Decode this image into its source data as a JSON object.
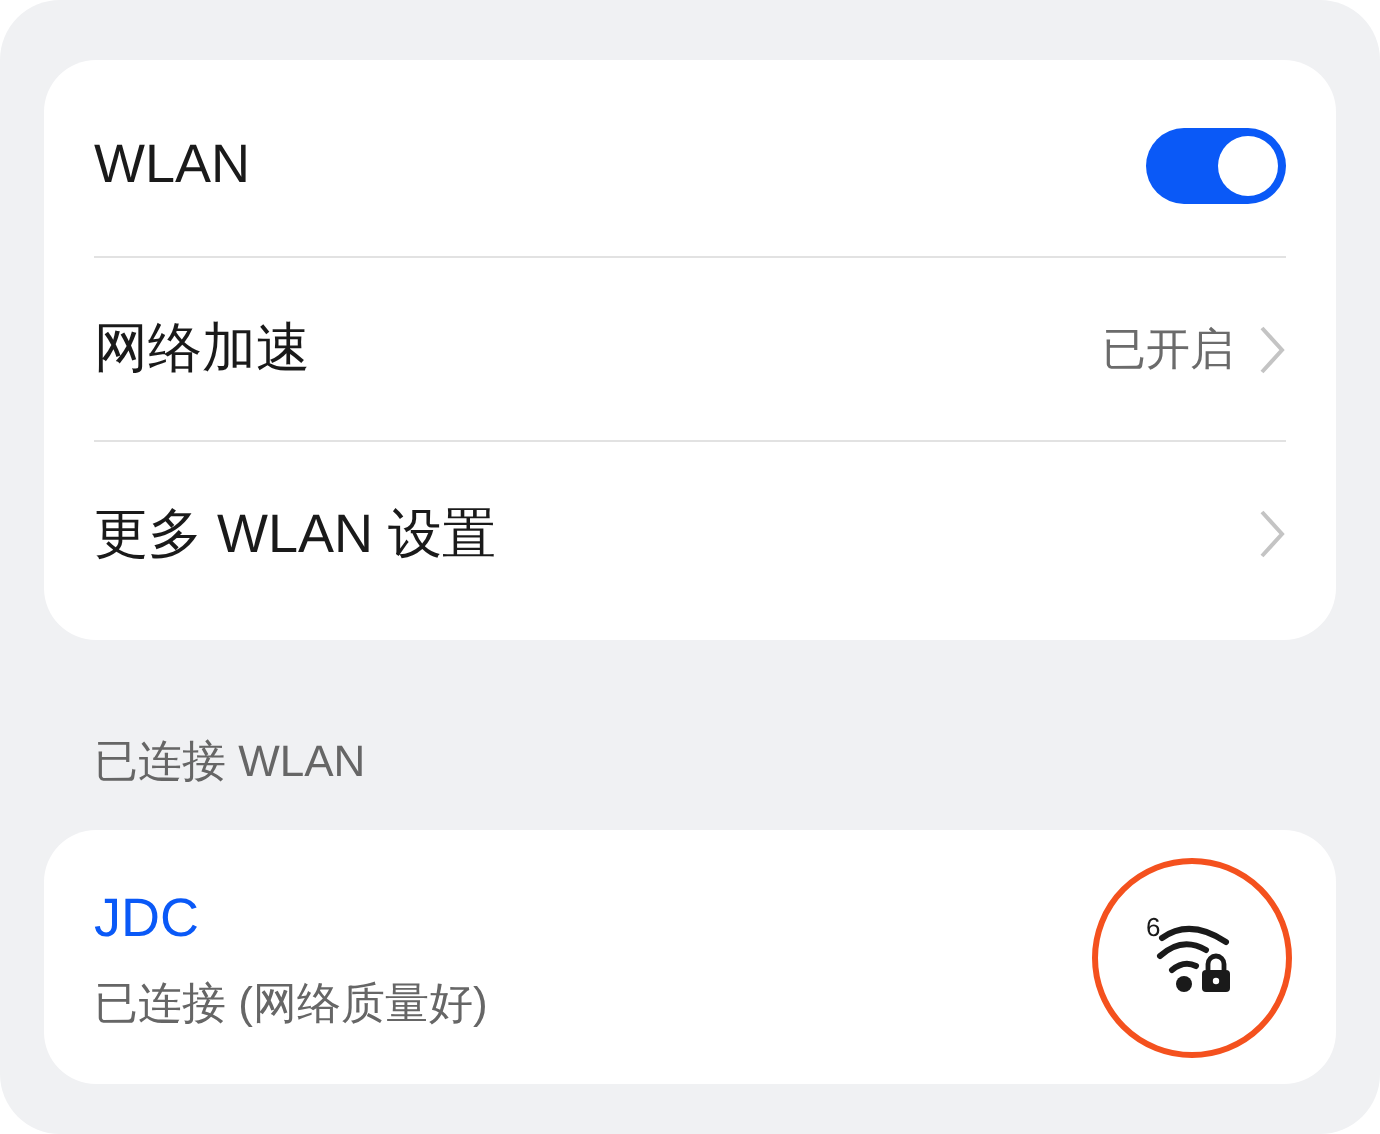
{
  "settings": [
    {
      "kind": "toggle",
      "label": "WLAN",
      "on": true
    },
    {
      "kind": "link",
      "label": "网络加速",
      "value": "已开启"
    },
    {
      "kind": "link",
      "label": "更多 WLAN 设置"
    }
  ],
  "connected_section": {
    "title": "已连接 WLAN",
    "networks": [
      {
        "name": "JDC",
        "status": "已连接 (网络质量好)",
        "wifi_badge": "6",
        "locked": true,
        "highlighted": true
      }
    ]
  }
}
